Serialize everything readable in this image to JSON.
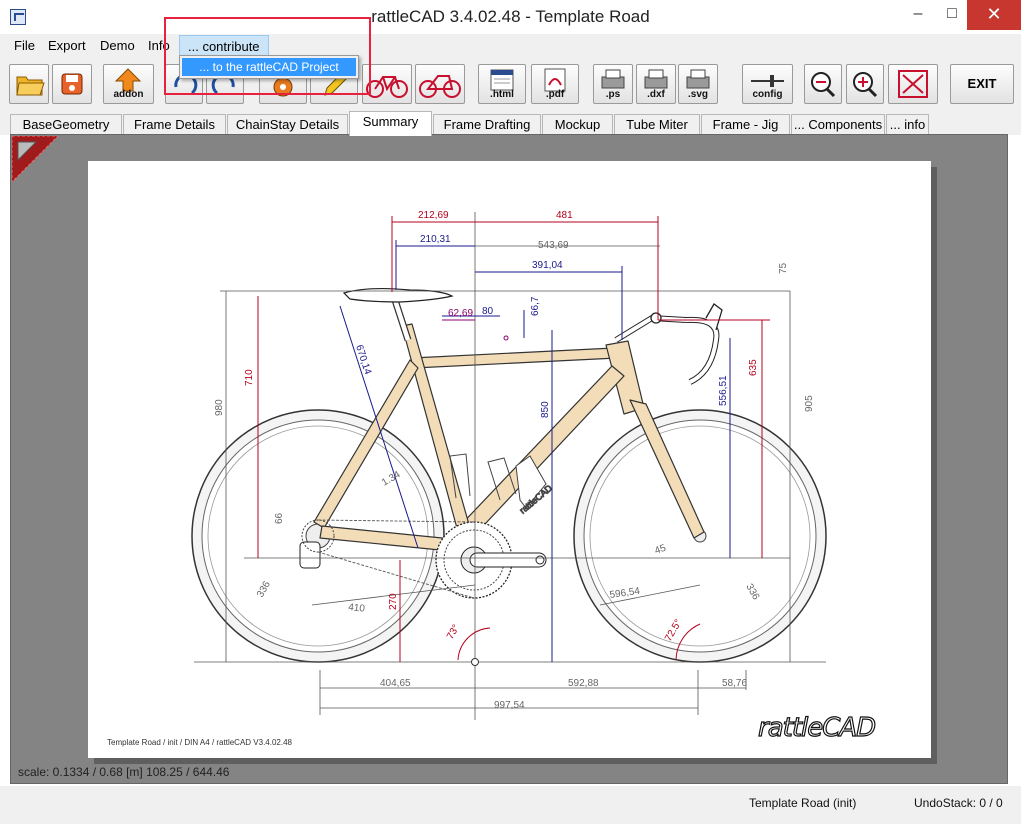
{
  "window": {
    "title": "rattleCAD  3.4.02.48 - Template Road"
  },
  "menubar": {
    "file": "File",
    "export": "Export",
    "demo": "Demo",
    "info": "Info",
    "contribute": "... contribute"
  },
  "contribute_menu": {
    "item": "... to the rattleCAD Project"
  },
  "toolbar": {
    "addon": "addon",
    "html": ".html",
    "pdf": ".pdf",
    "ps": ".ps",
    "dxf": ".dxf",
    "svg": ".svg",
    "config": "config",
    "exit": "EXIT"
  },
  "tabs": [
    "BaseGeometry",
    "Frame Details",
    "ChainStay Details",
    "Summary",
    "Frame Drafting",
    "Mockup",
    "Tube Miter",
    "Frame - Jig",
    "... Components",
    "... info"
  ],
  "selected_tab": "Summary",
  "drawing": {
    "dims": {
      "d212": "212,69",
      "d481": "481",
      "d210": "210,31",
      "d543": "543,69",
      "d391": "391,04",
      "d75": "75",
      "d62": "62,69",
      "d80": "80",
      "d66a": "66,7",
      "d710": "710",
      "d670": "670,14",
      "d980": "980",
      "d850": "850",
      "d556": "556,51",
      "d635": "635",
      "d905": "905",
      "d134": "1.34",
      "d66": "66",
      "d45": "45",
      "d336a": "336",
      "d336b": "336",
      "d410": "410",
      "d270": "270",
      "d596": "596,54",
      "ang73": "73°",
      "ang725": "72.5°",
      "d404": "404,65",
      "d592": "592,88",
      "d58": "58,76",
      "d997": "997,54"
    },
    "footer": "Template Road   /   init   / DIN A4 /   rattleCAD   V3.4.02.48",
    "logo": "rattleCAD"
  },
  "scale_status": "scale: 0.1334 / 0.68  [m]  108.25 / 644.46",
  "status": {
    "project": "Template Road (init)",
    "undo": "UndoStack:  0 / 0"
  },
  "colors": {
    "frame": "#f3ddb8",
    "frame_outline": "#333333",
    "dim_red": "#b5001c",
    "dim_blue": "#1a1a8c",
    "dim_purple": "#8b006b",
    "dim_gray": "#777777",
    "highlight": "#e8213f",
    "menu_selection": "#3399ff"
  }
}
